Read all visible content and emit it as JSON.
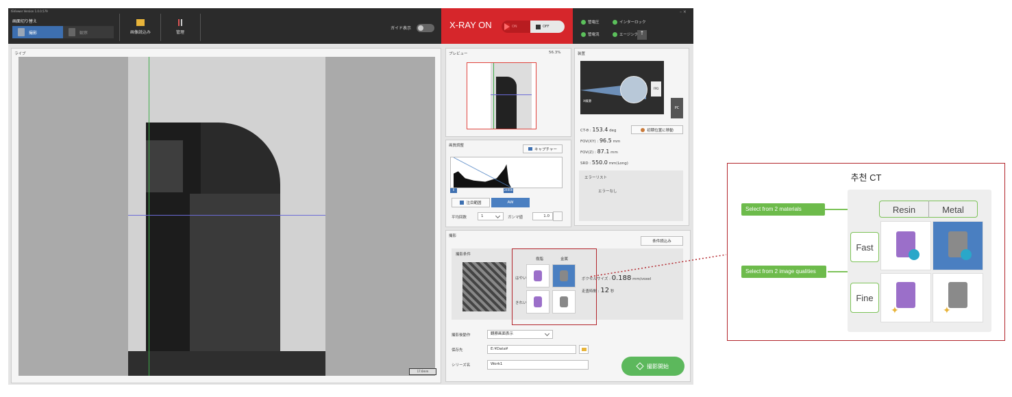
{
  "window": {
    "title": "ISViewer Version 1.0.0.579",
    "controls": "– ×"
  },
  "topbar": {
    "switch_label": "画面切り替え",
    "mode_capture": "撮影",
    "mode_observe": "観察",
    "tool_load": "画像読込み",
    "tool_manage": "管理",
    "guide_label": "ガイド表示",
    "xray_label": "X-RAY ON",
    "xray_on": "ON",
    "xray_off": "OFF",
    "status": [
      "管電圧",
      "インターロック",
      "管電流",
      "エージング"
    ]
  },
  "live": {
    "title": "ライブ",
    "scale": "17.6mm"
  },
  "preview": {
    "title": "プレビュー",
    "zoom": "56.3%"
  },
  "device": {
    "title": "装置",
    "fpd": "FPD",
    "xsrc": "X線源",
    "pc": "PC",
    "ct_label": "CT-θ",
    "ct_value": "153.4",
    "ct_unit": "deg",
    "home_btn": "初期位置に移動",
    "fovxy_label": "FOV(XY)",
    "fovxy_value": "96.5",
    "fovxy_unit": "mm",
    "fovz_label": "FOV(Z)",
    "fovz_value": "87.1",
    "fovz_unit": "mm",
    "srd_label": "SRD",
    "srd_value": "550.0",
    "srd_unit": "mm(Long)",
    "error_title": "エラーリスト",
    "error_text": "エラーなし"
  },
  "imgadj": {
    "title": "画質調整",
    "capture": "キャプチャー",
    "hist_min": "0",
    "hist_max": "24000",
    "roi_btn": "注目範囲",
    "aw_btn": "AW",
    "avg_label": "平均回数",
    "avg_value": "1",
    "gamma_label": "ガンマ値",
    "gamma_value": "1.0"
  },
  "shoot": {
    "title": "撮影",
    "load_cond": "条件読込み",
    "cond_title": "撮影条件",
    "col_resin": "樹脂",
    "col_metal": "金属",
    "row_fast": "はやい",
    "row_fine": "きれい",
    "voxel_label": "ボクセルサイズ",
    "voxel_value": "0.188",
    "voxel_unit": "mm/voxel",
    "time_label": "走査時間",
    "time_value": "12",
    "time_unit": "秒",
    "after_label": "撮影後動作",
    "after_value": "観察画面表示",
    "save_label": "保存先",
    "save_value": "E:¥Data¥",
    "series_label": "シリーズ名",
    "series_value": "Work1",
    "start_btn": "撮影開始"
  },
  "zoom": {
    "caption": "추천 CT",
    "resin": "Resin",
    "metal": "Metal",
    "fast": "Fast",
    "fine": "Fine",
    "tag_materials": "Select from 2 materials",
    "tag_qualities": "Select from 2 image qualities"
  },
  "colors": {
    "accent": "#4a7fc1",
    "xray": "#d6262b",
    "highlight": "#b2232a",
    "green": "#6dbb4b"
  }
}
